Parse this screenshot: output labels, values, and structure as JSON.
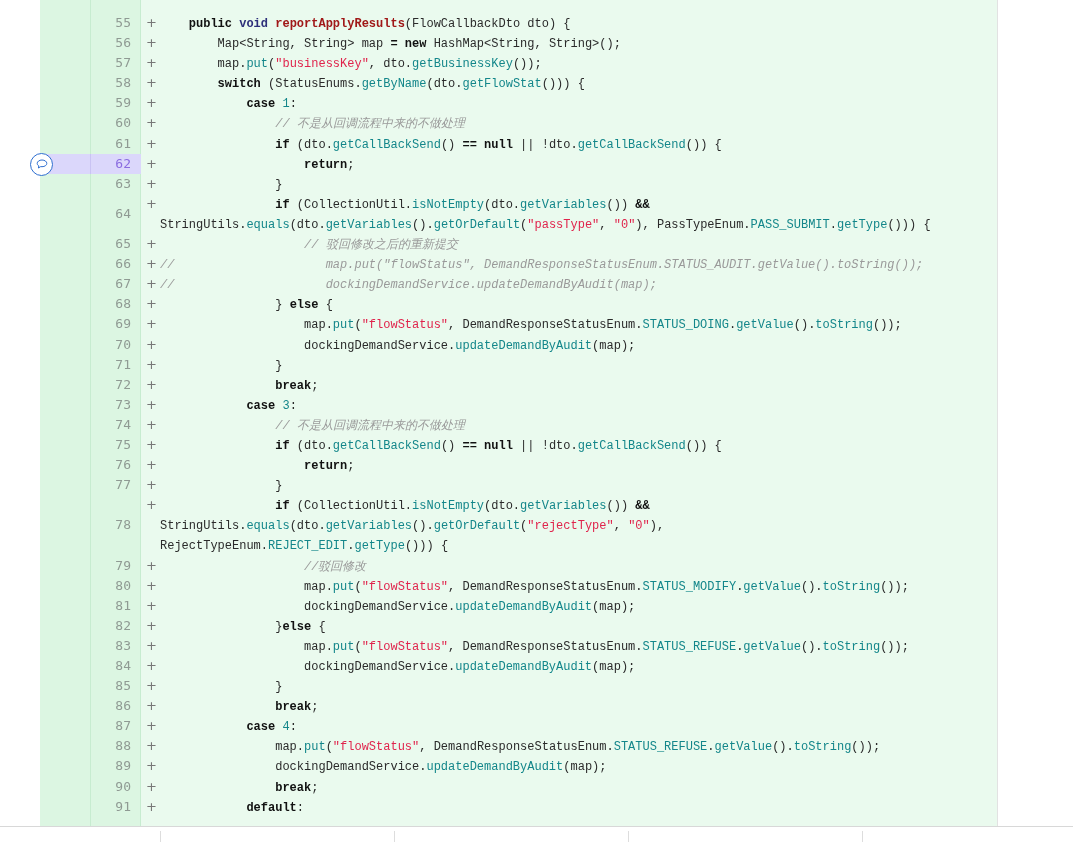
{
  "lines": [
    {
      "number": "55",
      "selected": false,
      "rows": [
        {
          "tokens": [
            {
              "kind": "kw",
              "text": "    public "
            },
            {
              "kind": "type",
              "text": "void "
            },
            {
              "kind": "decl",
              "text": "reportApplyResults"
            },
            {
              "kind": "plain",
              "text": "(FlowCallbackDto dto) {"
            }
          ]
        }
      ]
    },
    {
      "number": "56",
      "selected": false,
      "rows": [
        {
          "tokens": [
            {
              "kind": "plain",
              "text": "        Map<String, String> map "
            },
            {
              "kind": "kw",
              "text": "= new "
            },
            {
              "kind": "plain",
              "text": "HashMap<String, String>();"
            }
          ]
        }
      ]
    },
    {
      "number": "57",
      "selected": false,
      "rows": [
        {
          "tokens": [
            {
              "kind": "plain",
              "text": "        map."
            },
            {
              "kind": "fn",
              "text": "put"
            },
            {
              "kind": "plain",
              "text": "("
            },
            {
              "kind": "str",
              "text": "\"businessKey\""
            },
            {
              "kind": "plain",
              "text": ", dto."
            },
            {
              "kind": "fn",
              "text": "getBusinessKey"
            },
            {
              "kind": "plain",
              "text": "());"
            }
          ]
        }
      ]
    },
    {
      "number": "58",
      "selected": false,
      "rows": [
        {
          "tokens": [
            {
              "kind": "kw",
              "text": "        switch "
            },
            {
              "kind": "plain",
              "text": "(StatusEnums."
            },
            {
              "kind": "fn",
              "text": "getByName"
            },
            {
              "kind": "plain",
              "text": "(dto."
            },
            {
              "kind": "fn",
              "text": "getFlowStat"
            },
            {
              "kind": "plain",
              "text": "())) {"
            }
          ]
        }
      ]
    },
    {
      "number": "59",
      "selected": false,
      "rows": [
        {
          "tokens": [
            {
              "kind": "kw",
              "text": "            case "
            },
            {
              "kind": "num",
              "text": "1"
            },
            {
              "kind": "plain",
              "text": ":"
            }
          ]
        }
      ]
    },
    {
      "number": "60",
      "selected": false,
      "rows": [
        {
          "tokens": [
            {
              "kind": "cm",
              "text": "                // 不是从回调流程中来的不做处理"
            }
          ]
        }
      ]
    },
    {
      "number": "61",
      "selected": false,
      "rows": [
        {
          "tokens": [
            {
              "kind": "kw",
              "text": "                if "
            },
            {
              "kind": "plain",
              "text": "(dto."
            },
            {
              "kind": "fn",
              "text": "getCallBackSend"
            },
            {
              "kind": "plain",
              "text": "() "
            },
            {
              "kind": "kw",
              "text": "== null "
            },
            {
              "kind": "plain",
              "text": "|| !dto."
            },
            {
              "kind": "fn",
              "text": "getCallBackSend"
            },
            {
              "kind": "plain",
              "text": "()) {"
            }
          ]
        }
      ]
    },
    {
      "number": "62",
      "selected": true,
      "rows": [
        {
          "tokens": [
            {
              "kind": "kw",
              "text": "                    return"
            },
            {
              "kind": "plain",
              "text": ";"
            }
          ]
        }
      ]
    },
    {
      "number": "63",
      "selected": false,
      "rows": [
        {
          "tokens": [
            {
              "kind": "plain",
              "text": "                }"
            }
          ]
        }
      ]
    },
    {
      "number": "64",
      "selected": false,
      "rows": [
        {
          "tokens": [
            {
              "kind": "kw",
              "text": "                if "
            },
            {
              "kind": "plain",
              "text": "(CollectionUtil."
            },
            {
              "kind": "fn",
              "text": "isNotEmpty"
            },
            {
              "kind": "plain",
              "text": "(dto."
            },
            {
              "kind": "fn",
              "text": "getVariables"
            },
            {
              "kind": "plain",
              "text": "()) "
            },
            {
              "kind": "kw",
              "text": "&&"
            }
          ]
        },
        {
          "tokens": [
            {
              "kind": "plain",
              "text": "StringUtils."
            },
            {
              "kind": "fn",
              "text": "equals"
            },
            {
              "kind": "plain",
              "text": "(dto."
            },
            {
              "kind": "fn",
              "text": "getVariables"
            },
            {
              "kind": "plain",
              "text": "()."
            },
            {
              "kind": "fn",
              "text": "getOrDefault"
            },
            {
              "kind": "plain",
              "text": "("
            },
            {
              "kind": "str",
              "text": "\"passType\""
            },
            {
              "kind": "plain",
              "text": ", "
            },
            {
              "kind": "str",
              "text": "\"0\""
            },
            {
              "kind": "plain",
              "text": "), PassTypeEnum."
            },
            {
              "kind": "fn",
              "text": "PASS_SUBMIT"
            },
            {
              "kind": "plain",
              "text": "."
            },
            {
              "kind": "fn",
              "text": "getType"
            },
            {
              "kind": "plain",
              "text": "())) {"
            }
          ]
        }
      ]
    },
    {
      "number": "65",
      "selected": false,
      "rows": [
        {
          "tokens": [
            {
              "kind": "cm",
              "text": "                    // 驳回修改之后的重新提交"
            }
          ]
        }
      ]
    },
    {
      "number": "66",
      "selected": false,
      "rows": [
        {
          "tokens": [
            {
              "kind": "cm",
              "text": "//                     map.put(\"flowStatus\", DemandResponseStatusEnum.STATUS_AUDIT.getValue().toString());"
            }
          ]
        }
      ]
    },
    {
      "number": "67",
      "selected": false,
      "rows": [
        {
          "tokens": [
            {
              "kind": "cm",
              "text": "//                     dockingDemandService.updateDemandByAudit(map);"
            }
          ]
        }
      ]
    },
    {
      "number": "68",
      "selected": false,
      "rows": [
        {
          "tokens": [
            {
              "kind": "plain",
              "text": "                } "
            },
            {
              "kind": "kw",
              "text": "else "
            },
            {
              "kind": "plain",
              "text": "{"
            }
          ]
        }
      ]
    },
    {
      "number": "69",
      "selected": false,
      "rows": [
        {
          "tokens": [
            {
              "kind": "plain",
              "text": "                    map."
            },
            {
              "kind": "fn",
              "text": "put"
            },
            {
              "kind": "plain",
              "text": "("
            },
            {
              "kind": "str",
              "text": "\"flowStatus\""
            },
            {
              "kind": "plain",
              "text": ", DemandResponseStatusEnum."
            },
            {
              "kind": "fn",
              "text": "STATUS_DOING"
            },
            {
              "kind": "plain",
              "text": "."
            },
            {
              "kind": "fn",
              "text": "getValue"
            },
            {
              "kind": "plain",
              "text": "()."
            },
            {
              "kind": "fn",
              "text": "toString"
            },
            {
              "kind": "plain",
              "text": "());"
            }
          ]
        }
      ]
    },
    {
      "number": "70",
      "selected": false,
      "rows": [
        {
          "tokens": [
            {
              "kind": "plain",
              "text": "                    dockingDemandService."
            },
            {
              "kind": "fn",
              "text": "updateDemandByAudit"
            },
            {
              "kind": "plain",
              "text": "(map);"
            }
          ]
        }
      ]
    },
    {
      "number": "71",
      "selected": false,
      "rows": [
        {
          "tokens": [
            {
              "kind": "plain",
              "text": "                }"
            }
          ]
        }
      ]
    },
    {
      "number": "72",
      "selected": false,
      "rows": [
        {
          "tokens": [
            {
              "kind": "kw",
              "text": "                break"
            },
            {
              "kind": "plain",
              "text": ";"
            }
          ]
        }
      ]
    },
    {
      "number": "73",
      "selected": false,
      "rows": [
        {
          "tokens": [
            {
              "kind": "kw",
              "text": "            case "
            },
            {
              "kind": "num",
              "text": "3"
            },
            {
              "kind": "plain",
              "text": ":"
            }
          ]
        }
      ]
    },
    {
      "number": "74",
      "selected": false,
      "rows": [
        {
          "tokens": [
            {
              "kind": "cm",
              "text": "                // 不是从回调流程中来的不做处理"
            }
          ]
        }
      ]
    },
    {
      "number": "75",
      "selected": false,
      "rows": [
        {
          "tokens": [
            {
              "kind": "kw",
              "text": "                if "
            },
            {
              "kind": "plain",
              "text": "(dto."
            },
            {
              "kind": "fn",
              "text": "getCallBackSend"
            },
            {
              "kind": "plain",
              "text": "() "
            },
            {
              "kind": "kw",
              "text": "== null "
            },
            {
              "kind": "plain",
              "text": "|| !dto."
            },
            {
              "kind": "fn",
              "text": "getCallBackSend"
            },
            {
              "kind": "plain",
              "text": "()) {"
            }
          ]
        }
      ]
    },
    {
      "number": "76",
      "selected": false,
      "rows": [
        {
          "tokens": [
            {
              "kind": "kw",
              "text": "                    return"
            },
            {
              "kind": "plain",
              "text": ";"
            }
          ]
        }
      ]
    },
    {
      "number": "77",
      "selected": false,
      "rows": [
        {
          "tokens": [
            {
              "kind": "plain",
              "text": "                }"
            }
          ]
        }
      ]
    },
    {
      "number": "78",
      "selected": false,
      "rows": [
        {
          "tokens": [
            {
              "kind": "kw",
              "text": "                if "
            },
            {
              "kind": "plain",
              "text": "(CollectionUtil."
            },
            {
              "kind": "fn",
              "text": "isNotEmpty"
            },
            {
              "kind": "plain",
              "text": "(dto."
            },
            {
              "kind": "fn",
              "text": "getVariables"
            },
            {
              "kind": "plain",
              "text": "()) "
            },
            {
              "kind": "kw",
              "text": "&&"
            }
          ]
        },
        {
          "tokens": [
            {
              "kind": "plain",
              "text": "StringUtils."
            },
            {
              "kind": "fn",
              "text": "equals"
            },
            {
              "kind": "plain",
              "text": "(dto."
            },
            {
              "kind": "fn",
              "text": "getVariables"
            },
            {
              "kind": "plain",
              "text": "()."
            },
            {
              "kind": "fn",
              "text": "getOrDefault"
            },
            {
              "kind": "plain",
              "text": "("
            },
            {
              "kind": "str",
              "text": "\"rejectType\""
            },
            {
              "kind": "plain",
              "text": ", "
            },
            {
              "kind": "str",
              "text": "\"0\""
            },
            {
              "kind": "plain",
              "text": "),"
            }
          ]
        },
        {
          "tokens": [
            {
              "kind": "plain",
              "text": "RejectTypeEnum."
            },
            {
              "kind": "fn",
              "text": "REJECT_EDIT"
            },
            {
              "kind": "plain",
              "text": "."
            },
            {
              "kind": "fn",
              "text": "getType"
            },
            {
              "kind": "plain",
              "text": "())) {"
            }
          ]
        }
      ]
    },
    {
      "number": "79",
      "selected": false,
      "rows": [
        {
          "tokens": [
            {
              "kind": "cm",
              "text": "                    //驳回修改"
            }
          ]
        }
      ]
    },
    {
      "number": "80",
      "selected": false,
      "rows": [
        {
          "tokens": [
            {
              "kind": "plain",
              "text": "                    map."
            },
            {
              "kind": "fn",
              "text": "put"
            },
            {
              "kind": "plain",
              "text": "("
            },
            {
              "kind": "str",
              "text": "\"flowStatus\""
            },
            {
              "kind": "plain",
              "text": ", DemandResponseStatusEnum."
            },
            {
              "kind": "fn",
              "text": "STATUS_MODIFY"
            },
            {
              "kind": "plain",
              "text": "."
            },
            {
              "kind": "fn",
              "text": "getValue"
            },
            {
              "kind": "plain",
              "text": "()."
            },
            {
              "kind": "fn",
              "text": "toString"
            },
            {
              "kind": "plain",
              "text": "());"
            }
          ]
        }
      ]
    },
    {
      "number": "81",
      "selected": false,
      "rows": [
        {
          "tokens": [
            {
              "kind": "plain",
              "text": "                    dockingDemandService."
            },
            {
              "kind": "fn",
              "text": "updateDemandByAudit"
            },
            {
              "kind": "plain",
              "text": "(map);"
            }
          ]
        }
      ]
    },
    {
      "number": "82",
      "selected": false,
      "rows": [
        {
          "tokens": [
            {
              "kind": "plain",
              "text": "                }"
            },
            {
              "kind": "kw",
              "text": "else "
            },
            {
              "kind": "plain",
              "text": "{"
            }
          ]
        }
      ]
    },
    {
      "number": "83",
      "selected": false,
      "rows": [
        {
          "tokens": [
            {
              "kind": "plain",
              "text": "                    map."
            },
            {
              "kind": "fn",
              "text": "put"
            },
            {
              "kind": "plain",
              "text": "("
            },
            {
              "kind": "str",
              "text": "\"flowStatus\""
            },
            {
              "kind": "plain",
              "text": ", DemandResponseStatusEnum."
            },
            {
              "kind": "fn",
              "text": "STATUS_REFUSE"
            },
            {
              "kind": "plain",
              "text": "."
            },
            {
              "kind": "fn",
              "text": "getValue"
            },
            {
              "kind": "plain",
              "text": "()."
            },
            {
              "kind": "fn",
              "text": "toString"
            },
            {
              "kind": "plain",
              "text": "());"
            }
          ]
        }
      ]
    },
    {
      "number": "84",
      "selected": false,
      "rows": [
        {
          "tokens": [
            {
              "kind": "plain",
              "text": "                    dockingDemandService."
            },
            {
              "kind": "fn",
              "text": "updateDemandByAudit"
            },
            {
              "kind": "plain",
              "text": "(map);"
            }
          ]
        }
      ]
    },
    {
      "number": "85",
      "selected": false,
      "rows": [
        {
          "tokens": [
            {
              "kind": "plain",
              "text": "                }"
            }
          ]
        }
      ]
    },
    {
      "number": "86",
      "selected": false,
      "rows": [
        {
          "tokens": [
            {
              "kind": "kw",
              "text": "                break"
            },
            {
              "kind": "plain",
              "text": ";"
            }
          ]
        }
      ]
    },
    {
      "number": "87",
      "selected": false,
      "rows": [
        {
          "tokens": [
            {
              "kind": "kw",
              "text": "            case "
            },
            {
              "kind": "num",
              "text": "4"
            },
            {
              "kind": "plain",
              "text": ":"
            }
          ]
        }
      ]
    },
    {
      "number": "88",
      "selected": false,
      "rows": [
        {
          "tokens": [
            {
              "kind": "plain",
              "text": "                map."
            },
            {
              "kind": "fn",
              "text": "put"
            },
            {
              "kind": "plain",
              "text": "("
            },
            {
              "kind": "str",
              "text": "\"flowStatus\""
            },
            {
              "kind": "plain",
              "text": ", DemandResponseStatusEnum."
            },
            {
              "kind": "fn",
              "text": "STATUS_REFUSE"
            },
            {
              "kind": "plain",
              "text": "."
            },
            {
              "kind": "fn",
              "text": "getValue"
            },
            {
              "kind": "plain",
              "text": "()."
            },
            {
              "kind": "fn",
              "text": "toString"
            },
            {
              "kind": "plain",
              "text": "());"
            }
          ]
        }
      ]
    },
    {
      "number": "89",
      "selected": false,
      "rows": [
        {
          "tokens": [
            {
              "kind": "plain",
              "text": "                dockingDemandService."
            },
            {
              "kind": "fn",
              "text": "updateDemandByAudit"
            },
            {
              "kind": "plain",
              "text": "(map);"
            }
          ]
        }
      ]
    },
    {
      "number": "90",
      "selected": false,
      "rows": [
        {
          "tokens": [
            {
              "kind": "kw",
              "text": "                break"
            },
            {
              "kind": "plain",
              "text": ";"
            }
          ]
        }
      ]
    },
    {
      "number": "91",
      "selected": false,
      "rows": [
        {
          "tokens": [
            {
              "kind": "kw",
              "text": "            default"
            },
            {
              "kind": "plain",
              "text": ":"
            }
          ]
        }
      ]
    }
  ],
  "marker": "+"
}
